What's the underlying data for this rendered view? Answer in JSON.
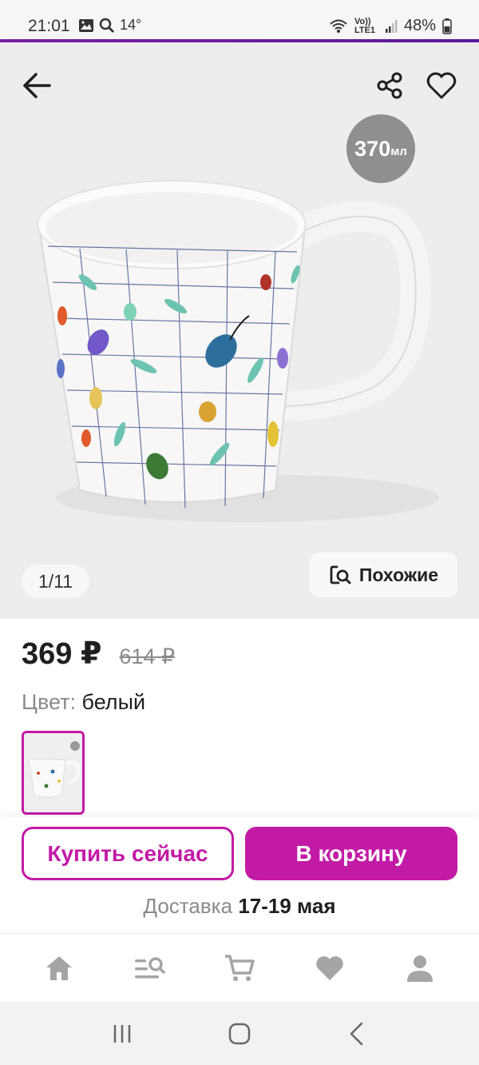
{
  "status_bar": {
    "time": "21:01",
    "temperature": "14°",
    "network": "Vo)) LTE1",
    "battery": "48%",
    "icons": [
      "gallery-icon",
      "search-icon",
      "wifi-icon",
      "signal-icon",
      "battery-icon"
    ]
  },
  "gallery": {
    "volume_number": "370",
    "volume_unit": "мл",
    "counter": "1/11",
    "similar_label": "Похожие",
    "icons": [
      "back-arrow-icon",
      "share-icon",
      "heart-icon",
      "image-search-icon"
    ]
  },
  "product": {
    "price": "369 ₽",
    "old_price": "614 ₽",
    "color_label": "Цвет:",
    "color_value": "белый"
  },
  "actions": {
    "buy_now": "Купить сейчас",
    "add_to_cart": "В корзину",
    "delivery_label": "Доставка",
    "delivery_dates": "17-19 мая"
  },
  "bottom_nav": {
    "items": [
      "home-icon",
      "catalog-search-icon",
      "cart-icon",
      "favorites-icon",
      "profile-icon"
    ]
  },
  "colors": {
    "accent": "#c31aa6",
    "accent_line": "#7b1fa2",
    "gallery_bg": "#ededed",
    "nav_icon": "#a5a5a5"
  }
}
